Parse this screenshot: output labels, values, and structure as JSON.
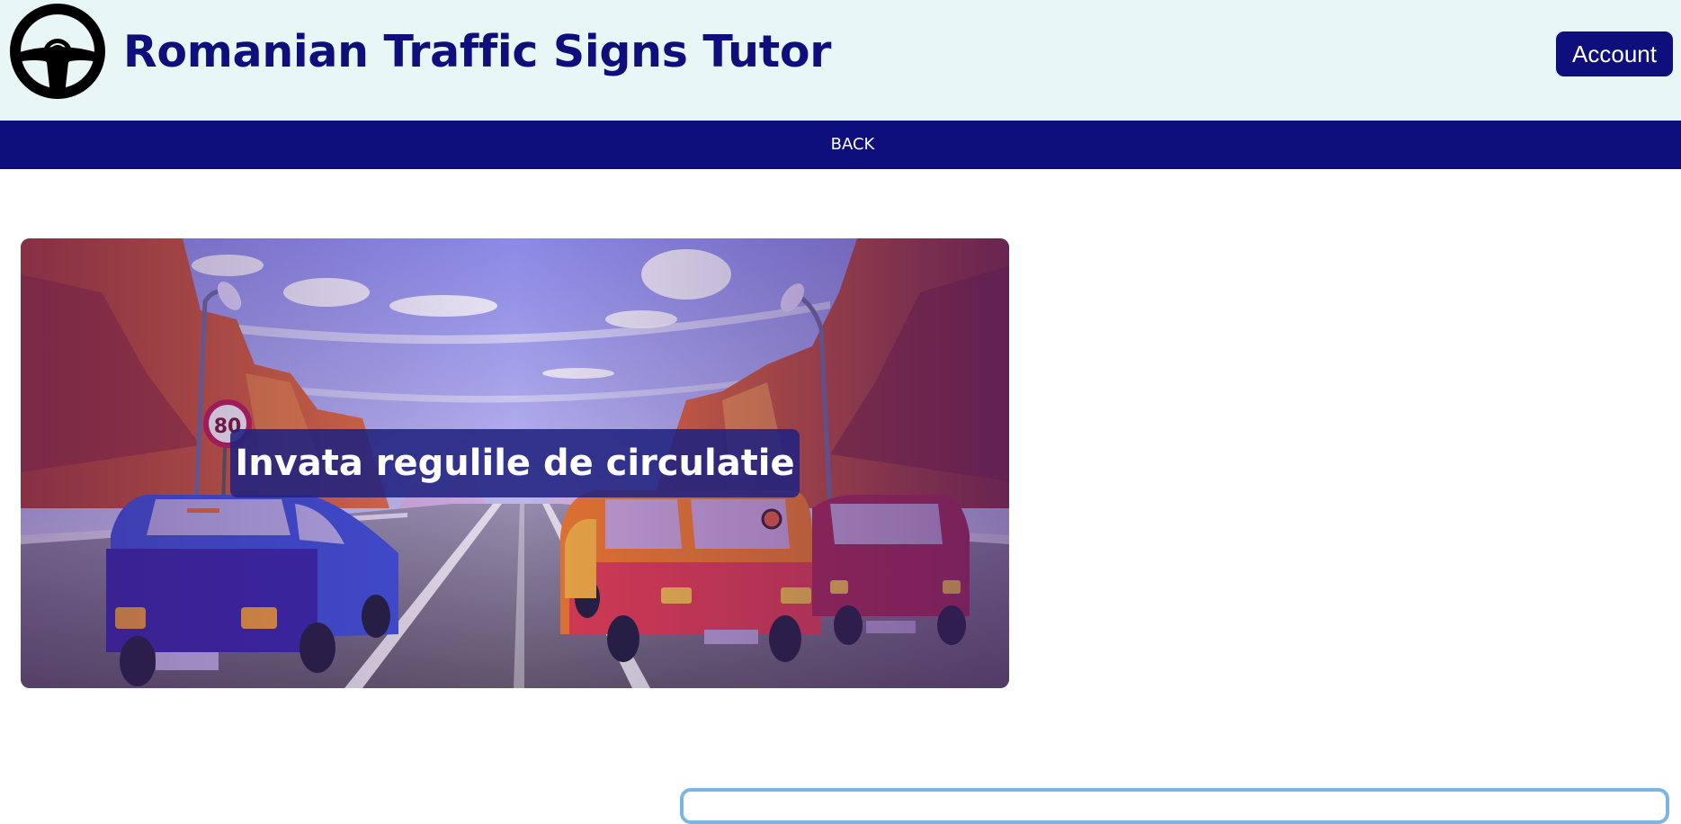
{
  "header": {
    "logo_icon": "steering-wheel-icon",
    "title": "Romanian Traffic Signs Tutor",
    "account_label": "Account"
  },
  "nav": {
    "back_label": "BACK"
  },
  "hero": {
    "caption": "Invata regulile de circulatie",
    "speed_sign": "80"
  },
  "colors": {
    "header_bg": "#e9f6f6",
    "brand_navy": "#0e0f7c",
    "card_border": "#7cb5e2"
  }
}
